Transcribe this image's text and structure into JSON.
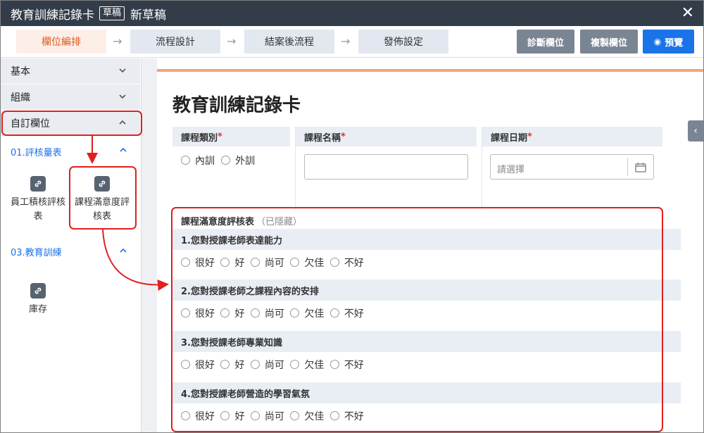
{
  "window": {
    "title": "教育訓練記錄卡",
    "badge": "草稿",
    "draft_name": "新草稿"
  },
  "steps": [
    {
      "label": "欄位編排",
      "active": true
    },
    {
      "label": "流程設計",
      "active": false
    },
    {
      "label": "結案後流程",
      "active": false
    },
    {
      "label": "發佈設定",
      "active": false
    }
  ],
  "toolbar": {
    "diagnose": "診斷欄位",
    "copy": "複製欄位",
    "preview": "預覽"
  },
  "sidebar": {
    "groups": [
      "基本",
      "組織",
      "自訂欄位"
    ],
    "subgroups": [
      "01.評核量表",
      "03.教育訓練"
    ],
    "items": [
      {
        "label": "員工積核評核表",
        "line1": "員工積核評核",
        "line2": "表"
      },
      {
        "label": "課程滿意度評核表",
        "line1": "課程滿意度評",
        "line2": "核表"
      },
      {
        "label": "庫存",
        "line1": "庫存",
        "line2": ""
      }
    ]
  },
  "form": {
    "title": "教育訓練記錄卡",
    "fields": [
      {
        "label": "課程類別",
        "options": [
          "內訓",
          "外訓"
        ]
      },
      {
        "label": "課程名稱",
        "value": ""
      },
      {
        "label": "課程日期",
        "placeholder": "請選擇"
      }
    ],
    "section": {
      "title": "課程滿意度評核表",
      "note": "（已隱藏）"
    },
    "questions": [
      "1.您對授課老師表達能力",
      "2.您對授課老師之課程內容的安排",
      "3.您對授課老師專業知識",
      "4.您對授課老師營造的學習氣氛"
    ],
    "rating_options": [
      "很好",
      "好",
      "尚可",
      "欠佳",
      "不好"
    ]
  },
  "colors": {
    "accent": "#e05a1f",
    "primary": "#1a73e8",
    "annotation": "#e02020"
  }
}
